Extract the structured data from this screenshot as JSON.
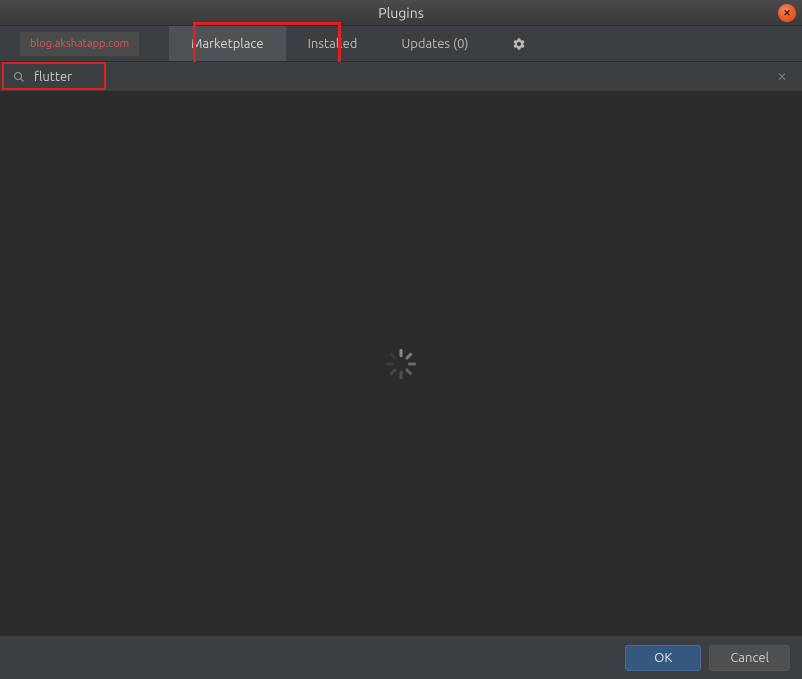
{
  "window": {
    "title": "Plugins"
  },
  "watermark": "blog.akshatapp.com",
  "tabs": {
    "marketplace": "Marketplace",
    "installed": "Installed",
    "updates": "Updates (0)"
  },
  "search": {
    "value": "flutter",
    "placeholder": ""
  },
  "footer": {
    "ok": "OK",
    "cancel": "Cancel"
  }
}
